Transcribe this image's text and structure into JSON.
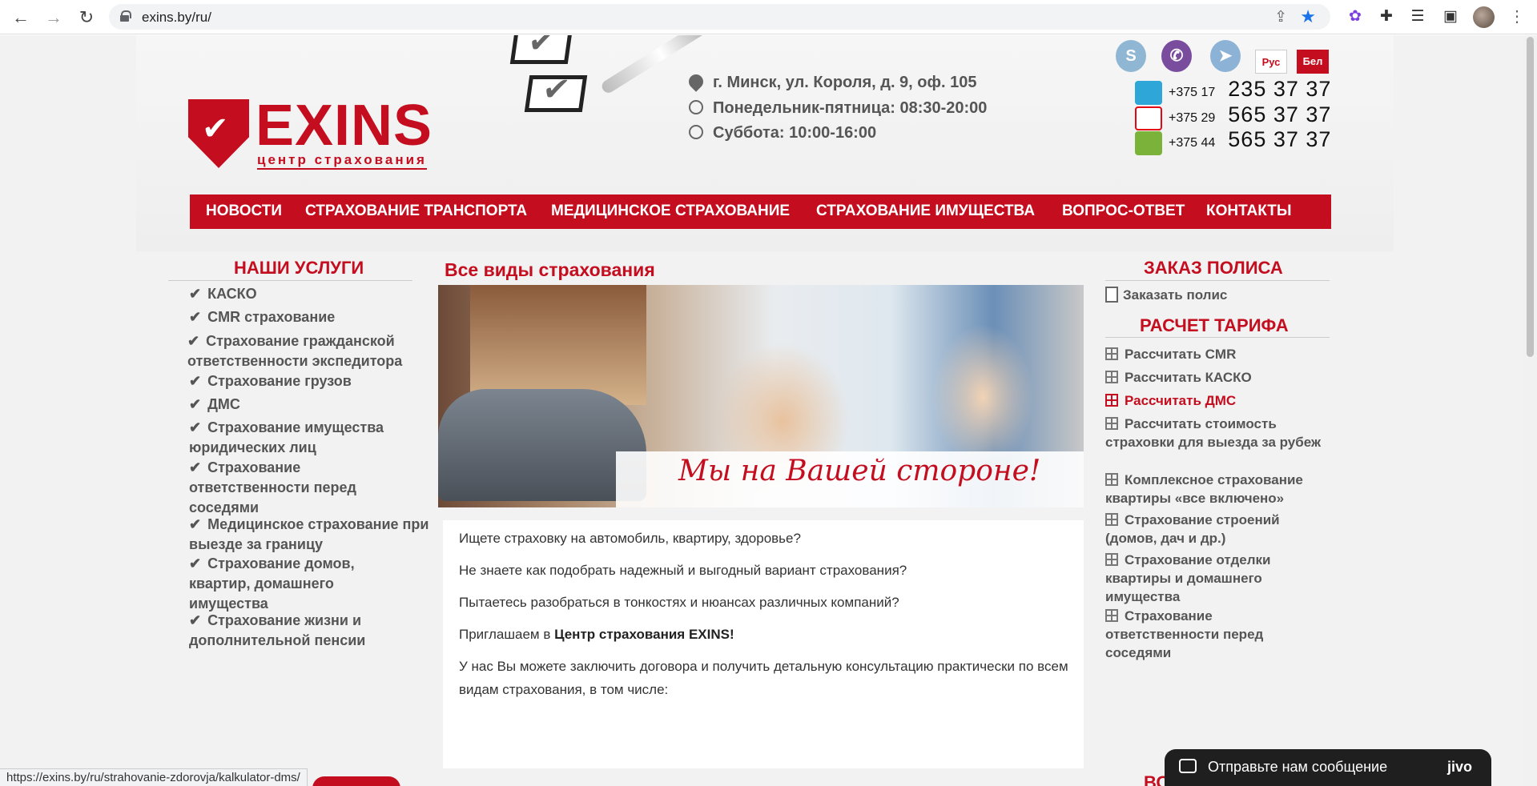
{
  "browser": {
    "url": "exins.by/ru/",
    "status_url": "https://exins.by/ru/strahovanie-zdorovja/kalkulator-dms/"
  },
  "header": {
    "languages": [
      "Рус",
      "Бел"
    ],
    "logo": {
      "title": "EXINS",
      "subtitle": "центр страхования"
    },
    "address": "г. Минск, ул. Короля, д. 9, оф. 105",
    "hours_weekdays": "Понедельник-пятница: 08:30-20:00",
    "hours_saturday": "Суббота: 10:00-16:00",
    "phones": [
      {
        "code": "+375 17",
        "number": "235 37 37"
      },
      {
        "code": "+375 29",
        "number": "565 37 37"
      },
      {
        "code": "+375 44",
        "number": "565 37 37"
      }
    ]
  },
  "menu": [
    "НОВОСТИ",
    "СТРАХОВАНИЕ ТРАНСПОРТА",
    "МЕДИЦИНСКОЕ СТРАХОВАНИЕ",
    "СТРАХОВАНИЕ ИМУЩЕСТВА",
    "ВОПРОС-ОТВЕТ",
    "КОНТАКТЫ"
  ],
  "services": {
    "title": "НАШИ УСЛУГИ",
    "items": [
      "КАСКО",
      "CMR страхование",
      "Страхование гражданской ответственности экспедитора",
      "Страхование грузов",
      "ДМС",
      "Страхование имущества юридических лиц",
      "Страхование ответственности перед соседями",
      "Медицинское страхование при выезде за границу",
      "Страхование домов, квартир, домашнего имущества",
      "Страхование жизни и дополнительной пенсии"
    ]
  },
  "center": {
    "title": "Все виды страхования",
    "banner_caption": "Мы на Вашей стороне!",
    "paragraphs": [
      "Ищете страховку на автомобиль, квартиру, здоровье?",
      "Не знаете как подобрать надежный и выгодный вариант страхования?",
      "Пытаетесь разобраться в тонкостях и нюансах различных компаний?"
    ],
    "invite_prefix": "Приглашаем в ",
    "invite_bold": "Центр страхования EXINS!",
    "last_paragraph": "У нас Вы можете заключить договора и получить детальную консультацию практически по всем видам страхования, в том числе:"
  },
  "right": {
    "order_title": "ЗАКАЗ ПОЛИСА",
    "order_link": "Заказать полис",
    "calc_title": "РАСЧЕТ ТАРИФА",
    "calc_items": [
      "Рассчитать CMR",
      "Рассчитать КАСКО",
      "Рассчитать ДМС",
      "Рассчитать стоимость страховки для выезда за рубеж",
      "Комплексное страхование квартиры «все включено»",
      "Страхование строений (домов, дач и др.)",
      "Страхование отделки квартиры и домашнего имущества",
      "Страхование ответственности перед соседями"
    ]
  },
  "chat": {
    "text": "Отправьте нам сообщение",
    "brand": "jivo"
  },
  "bottom_partial": "ВО",
  "colors": {
    "brand_red": "#c40d1e"
  }
}
